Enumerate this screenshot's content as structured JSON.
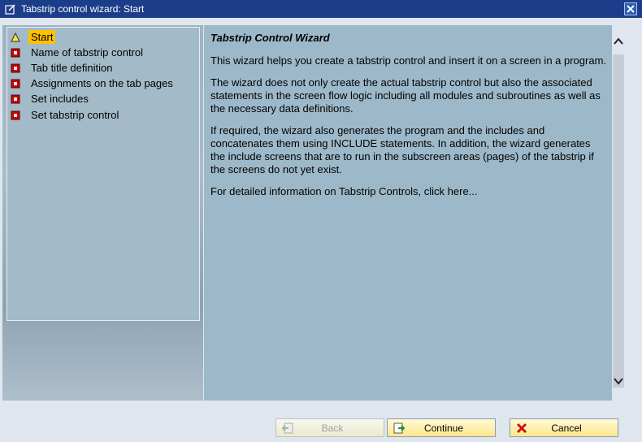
{
  "window": {
    "title": "Tabstrip control wizard: Start"
  },
  "steps": [
    {
      "label": "Start",
      "status": "current"
    },
    {
      "label": "Name of tabstrip control",
      "status": "pending"
    },
    {
      "label": "Tab title definition",
      "status": "pending"
    },
    {
      "label": "Assignments on the tab pages",
      "status": "pending"
    },
    {
      "label": "Set includes",
      "status": "pending"
    },
    {
      "label": "Set tabstrip control",
      "status": "pending"
    }
  ],
  "content": {
    "heading": "Tabstrip Control Wizard",
    "paragraphs": [
      "This wizard helps you create a tabstrip control and insert it on a screen in a program.",
      "The wizard does not only create the actual tabstrip control but also the associated statements in the screen flow logic including all modules and subroutines as well as the necessary data definitions.",
      "If required, the wizard also generates the program and the includes and concatenates them using INCLUDE statements. In addition, the wizard generates the include screens that are to run in the subscreen areas (pages) of the tabstrip if the screens do not yet exist.",
      "For detailed information on Tabstrip Controls, click here..."
    ]
  },
  "buttons": {
    "back": "Back",
    "continue": "Continue",
    "cancel": "Cancel"
  },
  "colors": {
    "titlebar": "#1c3d8a",
    "selected": "#ffc000",
    "content_bg": "#9db9c9",
    "step_pending": "#cc0000"
  }
}
